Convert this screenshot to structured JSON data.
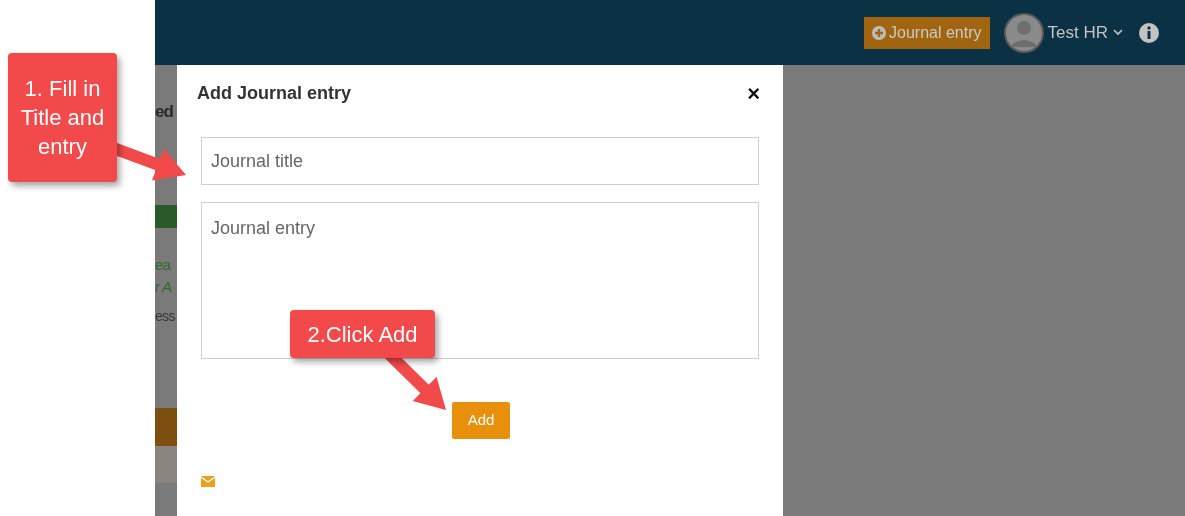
{
  "header": {
    "journal_button": "Journal entry",
    "user": "Test HR"
  },
  "background": {
    "fragments": [
      {
        "text": "ed",
        "kind": "heading"
      },
      {
        "text": "ea",
        "kind": "link"
      },
      {
        "text": "r A",
        "kind": "link"
      },
      {
        "text": "ess",
        "kind": "note"
      }
    ]
  },
  "modal": {
    "title": "Add Journal entry",
    "close": "×",
    "title_placeholder": "Journal title",
    "entry_placeholder": "Journal entry",
    "add_button": "Add"
  },
  "callouts": [
    {
      "text": "1. Fill in Title and entry"
    },
    {
      "text": "2.Click Add"
    }
  ]
}
